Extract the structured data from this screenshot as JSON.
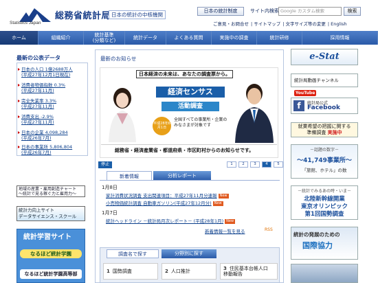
{
  "header": {
    "org_en": "Statistics Japan",
    "org_jp": "総務省統計局",
    "tagline": "日本の統計の中核機関",
    "system_button": "日本の統計制度",
    "search_label": "サイト内検索",
    "search_placeholder": "Google カスタム検索",
    "search_button": "検索",
    "util_links": [
      "ご意見・お問合せ",
      "サイトマップ",
      "文字サイズ等の変更",
      "English"
    ]
  },
  "nav": [
    "ホーム",
    "組織紹介",
    "統計基準\n(分類など)",
    "統計データ",
    "よくある質問",
    "実施中の調査",
    "統計研修",
    "採用情報"
  ],
  "left": {
    "news_title": "最新の公表データ",
    "news": [
      "日本の人口 1億2688万人\n(平成27年12月1日現在)",
      "消費者物価指数 0.3%\n(平成27年11月)",
      "完全失業率 3.3%\n(平成27年11月)",
      "消費支出 -2.9%\n(平成27年11月)",
      "日本の企業 4,098,284\n(平成26年7月)",
      "日本の事業所 5,806,804\n(平成26年7月)"
    ],
    "banner_chart": "地域の産業・雇用創造チャート\n～統計で見る稼ぐ力と雇用力～",
    "banner_ds": "統計力向上サイト\nデータサイエンス・スクール",
    "learn_title": "統計学習サイト",
    "learn_b1": "なるほど統計学園",
    "learn_b2": "なるほど統計学園高等部"
  },
  "center": {
    "latest_title": "最新のお知らせ",
    "hero_top": "日本経済の未来は、あなたの調査票から。",
    "hero_title1": "経済センサス",
    "hero_title2": "活動調査",
    "hero_date": "平成28年6月1日",
    "hero_target": "全国すべての事業所・企業の\nみなさまが対象です",
    "hero_bottom": "総務省・経済産業省・都道府県・市区町村からのお知らせです。",
    "stop": "停止",
    "pages": [
      "1",
      "2",
      "3",
      "4",
      "5"
    ],
    "current_page": "4",
    "tab_news": "新着情報",
    "tab_report": "分析レポート",
    "entries": [
      {
        "date": "1月8日",
        "items": [
          {
            "text": "家計消費状況調査 支出関連項目：平成27年11月分速報",
            "new": "New"
          },
          {
            "text": "小売物価統計調査 自動車ガソリン(平成27年12月分)",
            "new": "New"
          }
        ]
      },
      {
        "date": "1月7日",
        "items": [
          {
            "text": "統計ヘッドライン －統計局月次レポート－ (平成28年1月)",
            "new": "New"
          }
        ]
      }
    ],
    "more": "新着情報一覧を見る",
    "rss": "RSS",
    "tab_topic": "調査名で探す",
    "tab_field": "分野別に探す",
    "topics": [
      {
        "num": "1",
        "label": "国勢調査"
      },
      {
        "num": "2",
        "label": "人口推計"
      },
      {
        "num": "3",
        "label": "住民基本台帳人口\n移動報告"
      }
    ]
  },
  "right": {
    "estat": "e-Stat",
    "video": "統計局動画チャンネル",
    "youtube": "YouTube",
    "fb_small": "統計局公式",
    "fb_big": "Facebook",
    "job_line1": "就業希望の把握に関する",
    "job_line2": "準備調査",
    "job_status": "実施中",
    "topic_head": "－話題の数字－",
    "topic_num": "～41,749事業所～",
    "topic_sub": "「旅館、ホテル」の数",
    "see_head": "－統計でみるあの時・いま－",
    "see_lines": [
      "北陸新幹線開業",
      "東京オリンピック",
      "第1回国勢調査"
    ],
    "intl1": "統計の発展のための",
    "intl2": "国際協力"
  },
  "colors": {
    "nav": "#2a5aa8",
    "brand": "#1a3f8a",
    "new_badge": "#e05a20",
    "estat": "#1b4f9c"
  }
}
